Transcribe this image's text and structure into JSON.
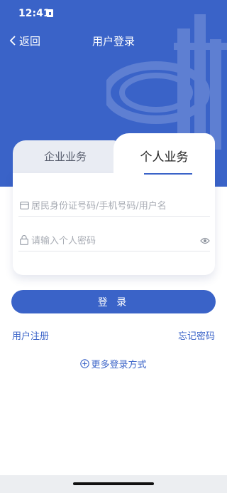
{
  "status": {
    "time": "12:41"
  },
  "nav": {
    "back_label": "返回",
    "title": "用户登录"
  },
  "tabs": {
    "enterprise": "企业业务",
    "personal": "个人业务"
  },
  "form": {
    "account_placeholder": "居民身份证号码/手机号码/用户名",
    "password_placeholder": "请输入个人密码"
  },
  "actions": {
    "login": "登 录",
    "register": "用户注册",
    "forgot": "忘记密码",
    "more_login": "更多登录方式"
  },
  "colors": {
    "brand": "#3a63c8"
  }
}
